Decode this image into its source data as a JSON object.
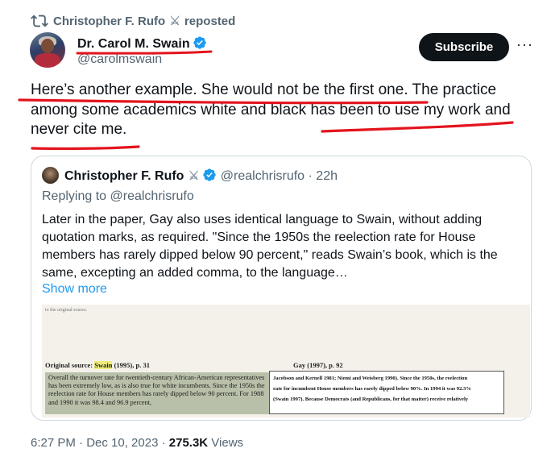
{
  "repost": {
    "user": "Christopher F. Rufo",
    "label": "reposted"
  },
  "author": {
    "name": "Dr. Carol M. Swain",
    "handle": "@carolmswain"
  },
  "subscribe_label": "Subscribe",
  "more_label": "···",
  "post": {
    "line1": "Here’s another example. She would not be the first one. The practice",
    "line2": "among some academics white and black has been to use my work and",
    "line3": "never cite me."
  },
  "quote": {
    "name": "Christopher F. Rufo",
    "handle": "@realchrisrufo",
    "time": "· 22h",
    "replying": "Replying to @realchrisrufo",
    "text": "Later in the paper, Gay also uses identical language to Swain, without adding quotation marks, as required. \"Since the 1950s the reelection rate for House members has rarely dipped below 90 percent,\" reads Swain’s book, which is the same, excepting an added comma, to the language…",
    "show_more": "Show more",
    "image": {
      "tiny_text": "to the original source.",
      "src_label_prefix": "Original source: ",
      "src_label_name": "Swain",
      "src_label_suffix": " (1995), p. 31",
      "gay_label": "Gay (1997), p. 92",
      "left_text": "Overall the turnover rate for twentieth-century African-American representatives has been extremely low, as is also true for white incumbents. Since the 1950s the reelection rate for House members has rarely dipped below 90 percent. For 1988 and 1990 it was 98.4 and 96.9 percent,",
      "right_l1": "Jacobson and Kernell 1981; Niemi and Weisberg 1990). Since the 1950s, the reelection",
      "right_l2": "rate for incumbent House members has rarely dipped below 90%. In 1994 it was 92.3%",
      "right_l3": "(Swain 1997). Because Democrats (and Republicans, for that matter) receive relatively"
    }
  },
  "footer": {
    "time": "6:27 PM · Dec 10, 2023 · ",
    "views_count": "275.3K",
    "views_label": " Views"
  },
  "colors": {
    "annotation_red": "#e3141e",
    "verified_blue": "#1d9bf0",
    "link_blue": "#1d9bf0"
  }
}
